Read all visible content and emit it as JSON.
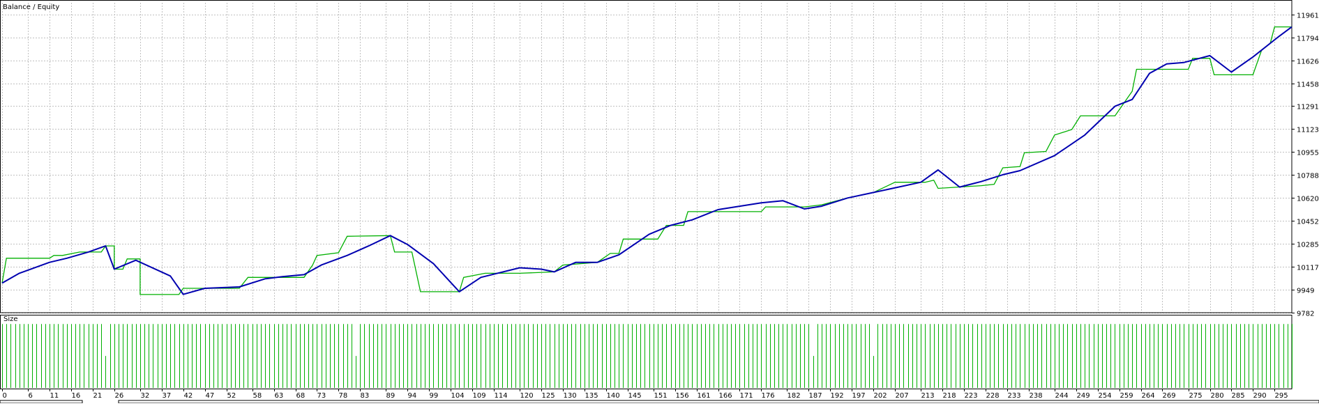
{
  "legend": {
    "balance": "Balance",
    "separator": " / ",
    "equity": "Equity"
  },
  "size_label": "Size",
  "colors": {
    "background": "#ffffff",
    "grid": "#c0c0c0",
    "frame": "#000000",
    "balance": "#0000b0",
    "equity": "#00b000",
    "size_bars": "#00b000",
    "label_text": "#000000"
  },
  "chart_data": {
    "type": "line",
    "title": "",
    "xlabel": "",
    "ylabel": "",
    "xlim": [
      0,
      299
    ],
    "ylim": [
      9782,
      12046
    ],
    "grid": true,
    "legend_position": "top-left",
    "y_ticks": [
      9782,
      9949,
      10117,
      10285,
      10452,
      10620,
      10788,
      10955,
      11123,
      11291,
      11458,
      11626,
      11794,
      11961
    ],
    "x_ticks": [
      0,
      6,
      11,
      16,
      21,
      26,
      32,
      37,
      42,
      47,
      52,
      58,
      63,
      68,
      73,
      78,
      83,
      89,
      94,
      99,
      104,
      109,
      114,
      120,
      125,
      130,
      135,
      140,
      145,
      151,
      156,
      161,
      166,
      171,
      176,
      182,
      187,
      192,
      197,
      202,
      207,
      213,
      218,
      223,
      228,
      233,
      238,
      244,
      249,
      254,
      259,
      264,
      269,
      275,
      280,
      285,
      290,
      295
    ],
    "series": [
      {
        "name": "Balance",
        "points": [
          [
            0,
            9998
          ],
          [
            4,
            10070
          ],
          [
            11,
            10150
          ],
          [
            15,
            10180
          ],
          [
            20,
            10225
          ],
          [
            24,
            10270
          ],
          [
            26,
            10100
          ],
          [
            31,
            10165
          ],
          [
            39,
            10050
          ],
          [
            42,
            9916
          ],
          [
            47,
            9960
          ],
          [
            55,
            9970
          ],
          [
            61,
            10030
          ],
          [
            65,
            10045
          ],
          [
            70,
            10060
          ],
          [
            74,
            10130
          ],
          [
            80,
            10200
          ],
          [
            85,
            10270
          ],
          [
            90,
            10345
          ],
          [
            94,
            10280
          ],
          [
            100,
            10140
          ],
          [
            106,
            9935
          ],
          [
            111,
            10040
          ],
          [
            120,
            10110
          ],
          [
            125,
            10100
          ],
          [
            128,
            10080
          ],
          [
            133,
            10150
          ],
          [
            138,
            10150
          ],
          [
            143,
            10205
          ],
          [
            150,
            10355
          ],
          [
            155,
            10420
          ],
          [
            160,
            10460
          ],
          [
            166,
            10535
          ],
          [
            176,
            10585
          ],
          [
            181,
            10600
          ],
          [
            186,
            10540
          ],
          [
            190,
            10560
          ],
          [
            196,
            10620
          ],
          [
            202,
            10660
          ],
          [
            213,
            10735
          ],
          [
            217,
            10825
          ],
          [
            222,
            10700
          ],
          [
            227,
            10740
          ],
          [
            232,
            10790
          ],
          [
            236,
            10820
          ],
          [
            244,
            10930
          ],
          [
            251,
            11080
          ],
          [
            258,
            11290
          ],
          [
            262,
            11340
          ],
          [
            266,
            11530
          ],
          [
            270,
            11600
          ],
          [
            274,
            11610
          ],
          [
            280,
            11660
          ],
          [
            285,
            11540
          ],
          [
            290,
            11650
          ],
          [
            296,
            11800
          ],
          [
            299,
            11870
          ]
        ]
      },
      {
        "name": "Equity",
        "points": [
          [
            0,
            9998
          ],
          [
            1,
            10180
          ],
          [
            11,
            10180
          ],
          [
            12,
            10200
          ],
          [
            14,
            10200
          ],
          [
            18,
            10225
          ],
          [
            23,
            10225
          ],
          [
            24,
            10270
          ],
          [
            26,
            10270
          ],
          [
            26,
            10100
          ],
          [
            28,
            10100
          ],
          [
            29,
            10175
          ],
          [
            32,
            10175
          ],
          [
            32,
            9915
          ],
          [
            41,
            9915
          ],
          [
            42,
            9960
          ],
          [
            47,
            9960
          ],
          [
            55,
            9960
          ],
          [
            57,
            10040
          ],
          [
            70,
            10040
          ],
          [
            72,
            10130
          ],
          [
            73,
            10200
          ],
          [
            78,
            10220
          ],
          [
            80,
            10340
          ],
          [
            90,
            10345
          ],
          [
            91,
            10225
          ],
          [
            95,
            10225
          ],
          [
            97,
            9935
          ],
          [
            106,
            9935
          ],
          [
            107,
            10040
          ],
          [
            112,
            10070
          ],
          [
            120,
            10070
          ],
          [
            128,
            10080
          ],
          [
            130,
            10130
          ],
          [
            138,
            10150
          ],
          [
            141,
            10215
          ],
          [
            143,
            10215
          ],
          [
            144,
            10320
          ],
          [
            152,
            10320
          ],
          [
            154,
            10420
          ],
          [
            158,
            10420
          ],
          [
            159,
            10520
          ],
          [
            176,
            10520
          ],
          [
            177,
            10555
          ],
          [
            186,
            10555
          ],
          [
            190,
            10570
          ],
          [
            196,
            10620
          ],
          [
            202,
            10660
          ],
          [
            207,
            10735
          ],
          [
            214,
            10735
          ],
          [
            216,
            10750
          ],
          [
            217,
            10690
          ],
          [
            227,
            10710
          ],
          [
            230,
            10720
          ],
          [
            232,
            10840
          ],
          [
            236,
            10850
          ],
          [
            237,
            10950
          ],
          [
            242,
            10960
          ],
          [
            244,
            11080
          ],
          [
            248,
            11120
          ],
          [
            250,
            11220
          ],
          [
            258,
            11220
          ],
          [
            260,
            11310
          ],
          [
            262,
            11400
          ],
          [
            263,
            11560
          ],
          [
            275,
            11560
          ],
          [
            276,
            11640
          ],
          [
            280,
            11640
          ],
          [
            281,
            11520
          ],
          [
            290,
            11520
          ],
          [
            292,
            11700
          ],
          [
            294,
            11750
          ],
          [
            295,
            11870
          ],
          [
            299,
            11870
          ]
        ]
      }
    ],
    "size": {
      "name": "Size",
      "count": 300,
      "step": 1,
      "level": 0.9,
      "short_bars": [
        24,
        82,
        188,
        202
      ],
      "short_level": 0.45
    }
  }
}
